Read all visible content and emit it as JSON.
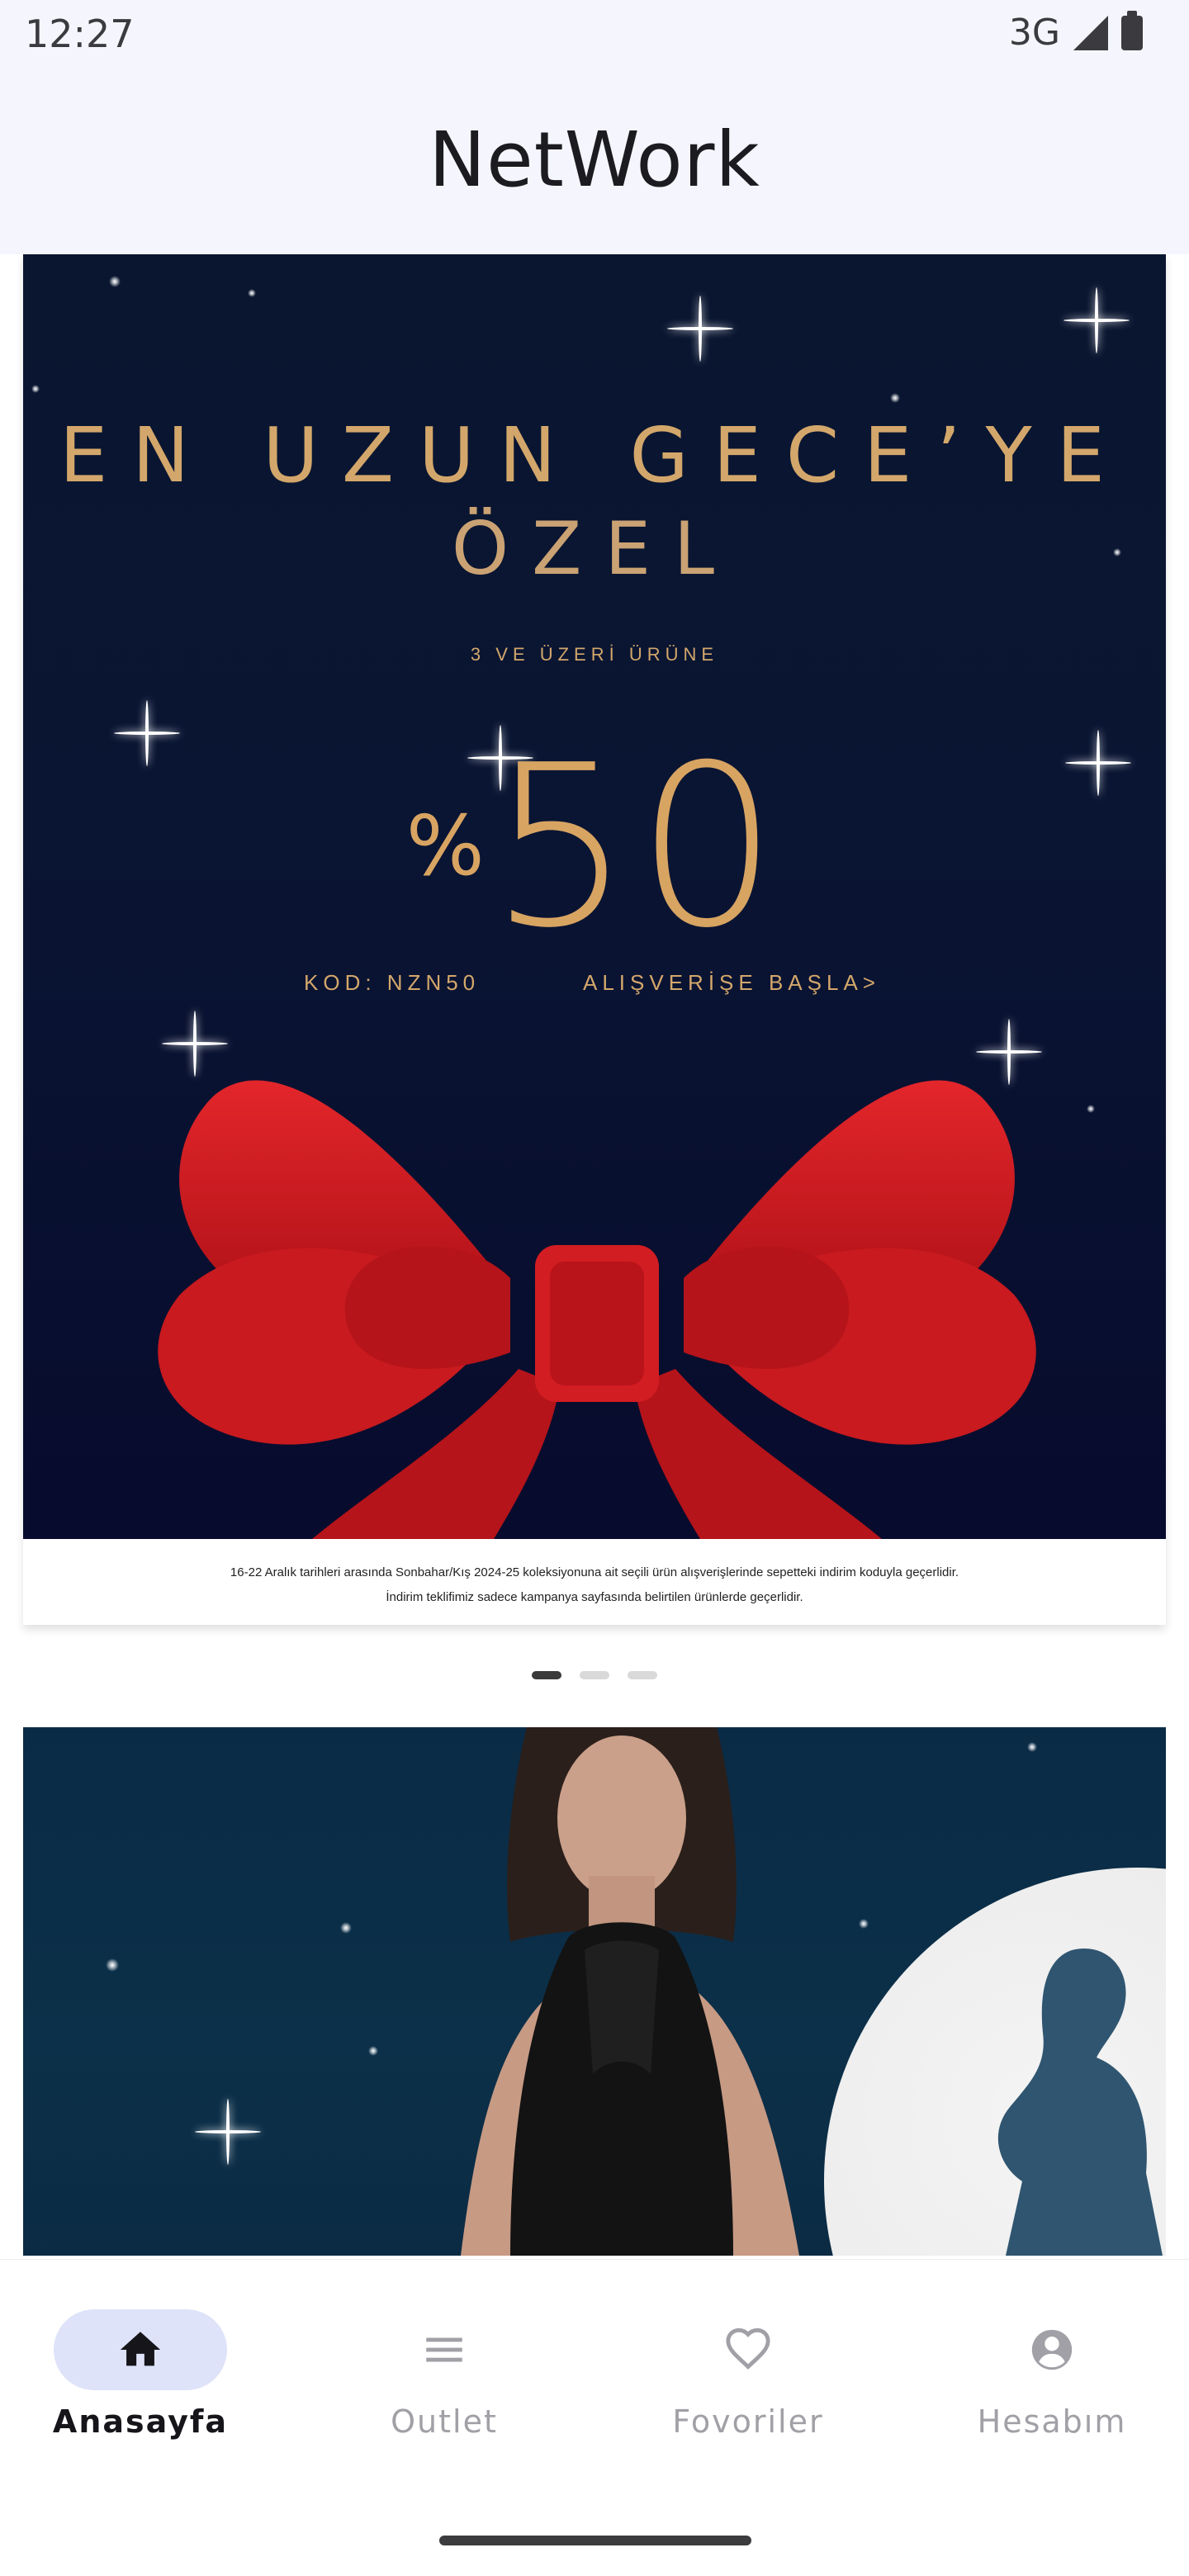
{
  "status_bar": {
    "time": "12:27",
    "network": "3G",
    "signal_icon": "signal-icon",
    "battery_icon": "battery-icon"
  },
  "app_bar": {
    "title": "NetWork"
  },
  "banner1": {
    "headline_line1": "EN UZUN GECE’YE",
    "headline_line2": "ÖZEL",
    "subheading": "3 VE ÜZERİ ÜRÜNE",
    "discount_symbol": "%",
    "discount_value": "50",
    "code": "KOD: NZN50",
    "cta": "ALIŞVERİŞE BAŞLA>",
    "disclaimer_line1": "16-22 Aralık tarihleri arasında Sonbahar/Kış 2024-25 koleksiyonuna ait seçili ürün alışverişlerinde sepetteki indirim koduyla geçerlidir.",
    "disclaimer_line2": "İndirim teklifimiz sadece kampanya sayfasında belirtilen ürünlerde geçerlidir."
  },
  "carousel": {
    "page_count": 3,
    "active_index": 0
  },
  "bottom_nav": {
    "items": [
      {
        "label": "Anasayfa",
        "icon": "home-icon",
        "active": true
      },
      {
        "label": "Outlet",
        "icon": "menu-icon",
        "active": false
      },
      {
        "label": "Fovoriler",
        "icon": "heart-icon",
        "active": false
      },
      {
        "label": "Hesabım",
        "icon": "account-icon",
        "active": false
      }
    ]
  },
  "colors": {
    "app_bar_bg": "#f5f6fd",
    "accent_gold": "#d3a76b",
    "nav_active_pill": "#dfe3f9",
    "bow_red": "#c8161c"
  }
}
